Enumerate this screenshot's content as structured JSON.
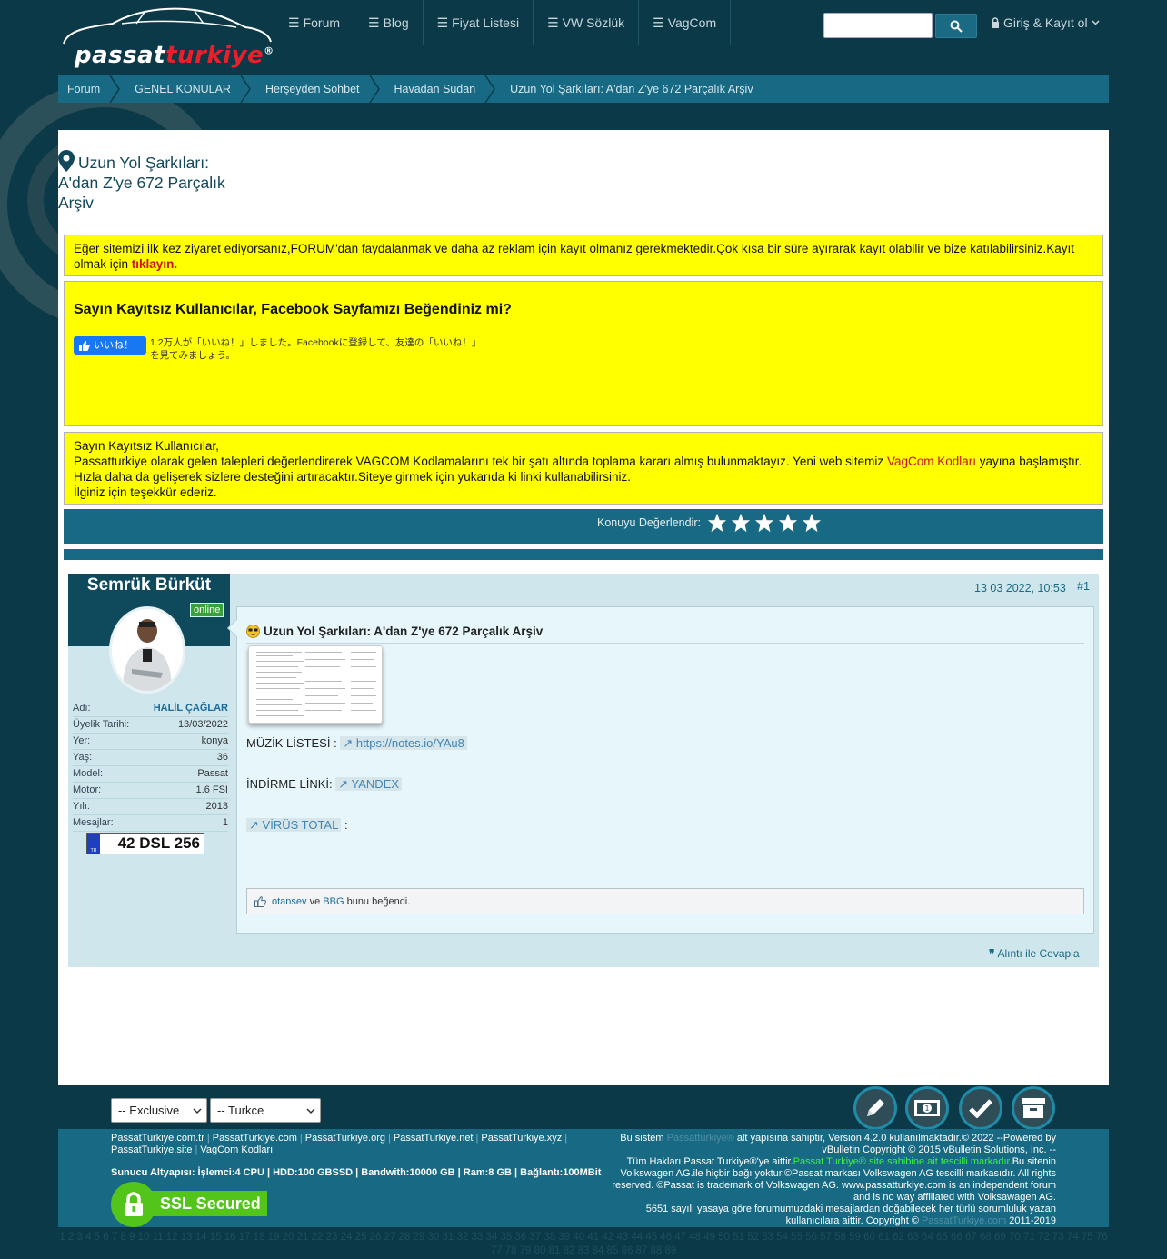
{
  "header": {
    "logo_text_main": "passat",
    "logo_text_accent": "turkiye",
    "logo_mark": "®",
    "nav": [
      {
        "label": "Forum",
        "icon": "bars-icon"
      },
      {
        "label": "Blog",
        "icon": "bars-icon"
      },
      {
        "label": "Fiyat Listesi",
        "icon": "bars-icon"
      },
      {
        "label": "VW Sözlük",
        "icon": "bars-icon"
      },
      {
        "label": "VagCom",
        "icon": "bars-icon"
      }
    ],
    "search_placeholder": "",
    "login_label": "Giriş & Kayıt ol"
  },
  "breadcrumb": [
    "Forum",
    "GENEL KONULAR",
    "Herşeyden Sohbet",
    "Havadan Sudan",
    "Uzun Yol Şarkıları: A'dan Z'ye 672 Parçalık Arşiv"
  ],
  "thread": {
    "title_line1": "Uzun Yol Şarkıları:",
    "title_line2": "A'dan Z'ye 672 Parçalık",
    "title_line3": "Arşiv"
  },
  "notices": {
    "register_text": "Eğer sitemizi ilk kez ziyaret ediyorsanız,FORUM'dan faydalanmak ve daha az reklam için kayıt olmanız gerekmektedir.Çok kısa bir süre ayırarak kayıt olabilir ve bize katılabilirsiniz.Kayıt olmak için",
    "register_link": "tıklayın.",
    "fb_title": "Sayın Kayıtsız Kullanıcılar, Facebook Sayfamızı Beğendiniz mi?",
    "fb_button": "いいね！",
    "fb_text": "1.2万人が「いいね！」しました。Facebookに登録して、友達の「いいね！」を見てみましょう。",
    "vag_line1": "Sayın Kayıtsız Kullanıcılar,",
    "vag_line2a": "Passatturkiye olarak gelen talepleri değerlendirerek VAGCOM Kodlamalarını tek bir şatı altında toplama kararı almış bulunmaktayız. Yeni web sitemiz",
    "vag_link": "VagCom Kodları",
    "vag_line2b": "yayına başlamıştır. Hızla daha da gelişerek sizlere desteğini artıracaktır.Siteye girmek için yukarıda ki linki kullanabilirsiniz.",
    "vag_line3": "İlginiz için teşekkür ederiz."
  },
  "rating": {
    "label": "Konuyu Değerlendir:",
    "stars": 5
  },
  "post": {
    "username": "Semrük Bürküt",
    "status": "online",
    "info": [
      {
        "label": "Adı:",
        "value": "HALİL ÇAĞLAR"
      },
      {
        "label": "Üyelik Tarihi:",
        "value": "13/03/2022"
      },
      {
        "label": "Yer:",
        "value": "konya"
      },
      {
        "label": "Yaş:",
        "value": "36"
      },
      {
        "label": "Model:",
        "value": "Passat"
      },
      {
        "label": "Motor:",
        "value": "1.6 FSI"
      },
      {
        "label": "Yılı:",
        "value": "2013"
      },
      {
        "label": "Mesajlar:",
        "value": "1"
      }
    ],
    "plate_country": "TR",
    "plate": "42 DSL 256",
    "date": "13 03 2022, 10:53",
    "number": "#1",
    "title": "Uzun Yol Şarkıları: A'dan Z'ye 672 Parçalık Arşiv",
    "music_label": "MÜZİK LİSTESİ :",
    "music_link": "https://notes.io/YAu8",
    "download_label": "İNDİRME LİNKİ:",
    "download_link": "YANDEX",
    "virus_link": "VİRÜS TOTAL",
    "virus_suffix": ":",
    "likes_user1": "otansev",
    "likes_and": "ve",
    "likes_user2": "BBG",
    "likes_suffix": "bunu beğendi.",
    "reply_label": "Alıntı ile Cevapla"
  },
  "footer": {
    "style_select": "-- Exclusive",
    "lang_select": "-- Turkce",
    "links": [
      "PassatTurkiye.com.tr",
      "PassatTurkiye.com",
      "PassatTurkiye.org",
      "PassatTurkiye.net",
      "PassatTurkiye.xyz",
      "PassatTurkiye.site",
      "VagCom Kodları"
    ],
    "server": "Sunucu Altyapısı: İşlemci:4 CPU | HDD:100 GBSSD | Bandwith:10000 GB | Ram:8 GB | Bağlantı:100MBit",
    "ssl": "SSL Secured",
    "copy1a": "Bu sistem",
    "copy1b": "Passatturkiye®",
    "copy1c": "alt yapısına sahiptir, Version 4.2.0 kullanılmaktadır.© 2022 --Powered by vBulletin Copyright © 2015 vBulletin Solutions, Inc. --",
    "copy2a": "Tüm Hakları Passat Turkiye®'ye aittir.",
    "copy2b": "Passat Turkiye® site sahibine ait tescilli markadır.",
    "copy2c": "Bu sitenin Volkswagen AG.ile hiçbir bağı yoktur.©Passat markası Volkswagen AG tescilli markasıdır. All rights reserved. ©Passat is trademark of Volkswagen AG. www.passatturkiye.com is an independent forum and is no way affiliated with Volksawagen AG.",
    "copy3a": "5651 sayılı yasaya göre forumumuzdaki mesajlardan doğabilecek her türlü sorumluluk yazan kullanıcılara aittir. Copyright ©",
    "copy3b": "PassatTurkiye.com",
    "copy3c": "2011-2019",
    "pages": "1 2 3 4 5 6 7 8 9 10 11 12 13 14 15 16 17 18 19 20 21 22 23 24 25 26 27 28 29 30 31 32 33 34 35 36 37 38 39 40 41 42 43 44 45 46 47 48 49 50 51 52 53 54 55 56 57 58 59 60 61 62 63 64 65 66 67 68 69 70 71 72 73 74 75 76 77 78 79 80 81 82 83 84 85 86 87 88 89"
  }
}
